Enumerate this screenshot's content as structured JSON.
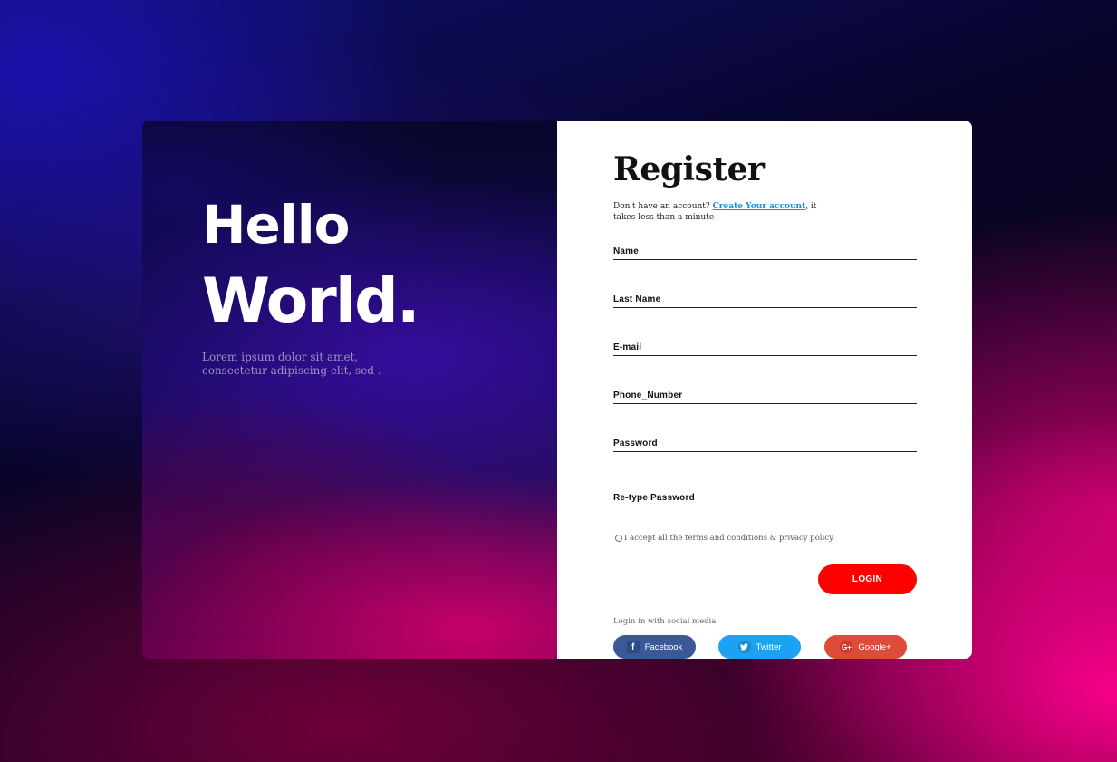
{
  "hero": {
    "line1": "Hello",
    "line2": "World.",
    "description": "Lorem ipsum dolor sit amet, consectetur adipiscing elit, sed ."
  },
  "register": {
    "title": "Register",
    "subtitle_prefix": "Don't have an account? ",
    "subtitle_link": "Create Your account",
    "subtitle_suffix": ", it takes less than a minute",
    "fields": [
      {
        "label": "Name"
      },
      {
        "label": "Last Name"
      },
      {
        "label": "E-mail"
      },
      {
        "label": "Phone_Number"
      },
      {
        "label": "Password"
      },
      {
        "label": "Re-type Password"
      }
    ],
    "terms": "I accept all the terms and conditions & privacy policy.",
    "login_button": "LOGIN",
    "social_caption": "Login in with social media",
    "social": {
      "facebook": "Facebook",
      "twitter": "Twitter",
      "google": "Google+"
    }
  },
  "colors": {
    "login_button": "#ff0000",
    "link": "#1a8fd6",
    "facebook": "#3b5998",
    "twitter": "#1da1f2",
    "google": "#dd4b39"
  },
  "icons": {
    "facebook": "facebook-icon",
    "twitter": "twitter-icon",
    "google": "google-plus-icon"
  }
}
